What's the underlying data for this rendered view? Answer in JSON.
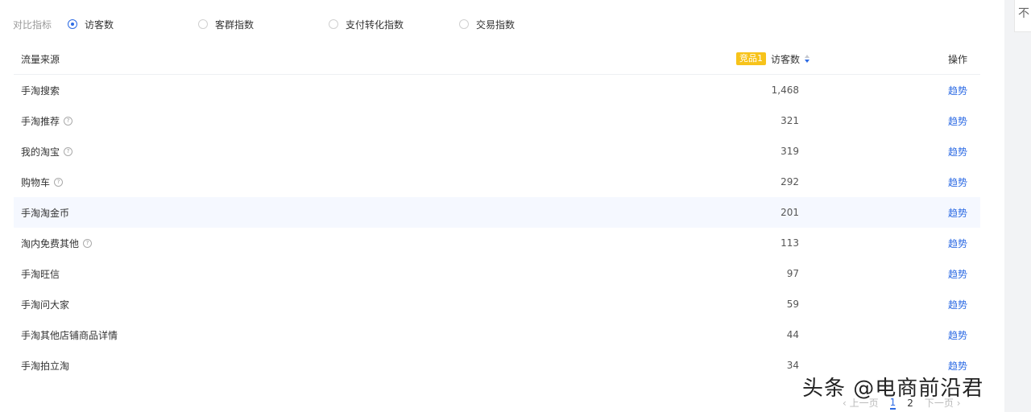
{
  "metric_selector": {
    "label": "对比指标",
    "options": [
      {
        "label": "访客数",
        "checked": true
      },
      {
        "label": "客群指数",
        "checked": false
      },
      {
        "label": "支付转化指数",
        "checked": false
      },
      {
        "label": "交易指数",
        "checked": false
      }
    ]
  },
  "table": {
    "headers": {
      "source": "流量来源",
      "tag": "竞品1",
      "visitors": "访客数",
      "action": "操作"
    },
    "rows": [
      {
        "source": "手淘搜索",
        "visitors": "1,468",
        "help": false,
        "action": "趋势"
      },
      {
        "source": "手淘推荐",
        "visitors": "321",
        "help": true,
        "action": "趋势"
      },
      {
        "source": "我的淘宝",
        "visitors": "319",
        "help": true,
        "action": "趋势"
      },
      {
        "source": "购物车",
        "visitors": "292",
        "help": true,
        "action": "趋势"
      },
      {
        "source": "手淘淘金币",
        "visitors": "201",
        "help": false,
        "action": "趋势"
      },
      {
        "source": "淘内免费其他",
        "visitors": "113",
        "help": true,
        "action": "趋势"
      },
      {
        "source": "手淘旺信",
        "visitors": "97",
        "help": false,
        "action": "趋势"
      },
      {
        "source": "手淘问大家",
        "visitors": "59",
        "help": false,
        "action": "趋势"
      },
      {
        "source": "手淘其他店铺商品详情",
        "visitors": "44",
        "help": false,
        "action": "趋势"
      },
      {
        "source": "手淘拍立淘",
        "visitors": "34",
        "help": false,
        "action": "趋势"
      }
    ]
  },
  "pagination": {
    "prev": "‹ 上一页",
    "pages": [
      "1",
      "2"
    ],
    "next": "下一页 ›"
  },
  "watermark": "头条 @电商前沿君",
  "right_box_text": "不",
  "colors": {
    "accent": "#2d6be4",
    "tag_bg": "#f7c31a",
    "row_highlight": "#f5f8ff"
  }
}
